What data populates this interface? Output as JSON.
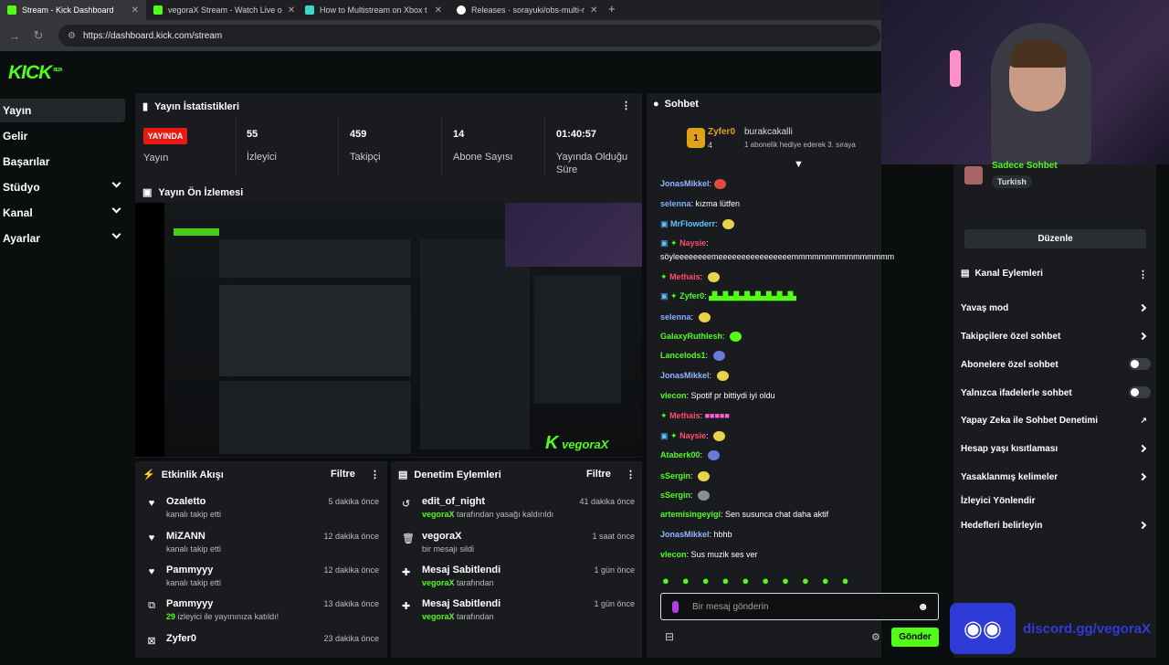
{
  "browser": {
    "tabs": [
      {
        "title": "Stream - Kick Dashboard",
        "active": true,
        "color": "#53fc18"
      },
      {
        "title": "vegoraX Stream - Watch Live o",
        "active": false,
        "color": "#53fc18"
      },
      {
        "title": "How to Multistream on Xbox t",
        "active": false,
        "color": "#3dd6c8"
      },
      {
        "title": "Releases · sorayuki/obs-multi-r",
        "active": false,
        "color": "#ffffff"
      }
    ],
    "url": "https://dashboard.kick.com/stream"
  },
  "brand": {
    "logo": "KICK",
    "logo_sup": "BETA",
    "accent": "#53fc18"
  },
  "sidebar": {
    "items": [
      {
        "label": "Yayın",
        "active": true
      },
      {
        "label": "Gelir"
      },
      {
        "label": "Başarılar"
      },
      {
        "label": "Stüdyo",
        "expandable": true
      },
      {
        "label": "Kanal",
        "expandable": true
      },
      {
        "label": "Ayarlar",
        "expandable": true
      }
    ]
  },
  "stats": {
    "title": "Yayın İstatistikleri",
    "live_badge": "YAYINDA",
    "live_label": "Yayın",
    "cells": [
      {
        "value": "55",
        "label": "İzleyici"
      },
      {
        "value": "459",
        "label": "Takipçi"
      },
      {
        "value": "14",
        "label": "Abone Sayısı"
      },
      {
        "value": "01:40:57",
        "label": "Yayında Olduğu Süre"
      }
    ]
  },
  "preview": {
    "title": "Yayın Ön İzlemesi",
    "watermark": "vegoraX"
  },
  "activity": {
    "title": "Etkinlik Akışı",
    "filter": "Filtre",
    "rows": [
      {
        "icon": "heart-icon",
        "glyph": "♥",
        "name": "Ozaletto",
        "sub": "kanalı takip etti",
        "time": "5 dakika önce"
      },
      {
        "icon": "heart-icon",
        "glyph": "♥",
        "name": "MiZANN",
        "sub": "kanalı takip etti",
        "time": "12 dakika önce"
      },
      {
        "icon": "heart-icon",
        "glyph": "♥",
        "name": "Pammyyy",
        "sub": "kanalı takip etti",
        "time": "12 dakika önce"
      },
      {
        "icon": "raid-icon",
        "glyph": "⧉",
        "name": "Pammyyy",
        "sub_count": "29",
        "sub": "izleyici ile yayınınıza katıldı!",
        "time": "13 dakika önce"
      },
      {
        "icon": "kick-icon",
        "glyph": "⊠",
        "name": "Zyfer0",
        "sub": "",
        "time": "23 dakika önce"
      }
    ]
  },
  "moderation": {
    "title": "Denetim Eylemleri",
    "filter": "Filtre",
    "rows": [
      {
        "icon": "undo-icon",
        "glyph": "↺",
        "name": "edit_of_night",
        "actor": "vegoraX",
        "sub": "tarafından yasağı kaldırıldı",
        "time": "41 dakika önce"
      },
      {
        "icon": "trash-icon",
        "glyph": "🗑",
        "name": "vegoraX",
        "actor": "",
        "sub": "bir mesajı sildi",
        "time": "1 saat önce"
      },
      {
        "icon": "pin-icon",
        "glyph": "📌",
        "name": "Mesaj Sabitlendi",
        "actor": "vegoraX",
        "sub": "tarafından",
        "time": "1 gün önce"
      },
      {
        "icon": "pin-icon",
        "glyph": "📌",
        "name": "Mesaj Sabitlendi",
        "actor": "vegoraX",
        "sub": "tarafından",
        "time": "1 gün önce"
      }
    ]
  },
  "chat": {
    "title": "Sohbet",
    "gifter": {
      "name": "Zyfer0",
      "count": "4",
      "rank": "1"
    },
    "recipient": {
      "name": "burakcakalli",
      "note": "1 abonelik hediye ederek 3. sıraya"
    },
    "messages": [
      {
        "user": "JonasMikkel",
        "color": "#8fb7ff",
        "text": ""
      },
      {
        "user": "selenna",
        "color": "#7fb3ff",
        "text": "kızma lütfen"
      },
      {
        "user": "MrFlowderr",
        "color": "#5ac8ff",
        "text": ""
      },
      {
        "user": "Naysie",
        "color": "#ff4d6d",
        "text": ""
      },
      {
        "user": "",
        "color": "#fff",
        "text": "söyleeeeeeeemeeeeeeeeeeeeeeeemmmmmmmmmmmmmmm"
      },
      {
        "user": "Methais",
        "color": "#ff4d6d",
        "text": ""
      },
      {
        "user": "Zyfer0",
        "color": "#53fc18",
        "text": ""
      },
      {
        "user": "selenna",
        "color": "#7fb3ff",
        "text": ""
      },
      {
        "user": "GalaxyRuthlesh",
        "color": "#53fc18",
        "text": ""
      },
      {
        "user": "Lancelods1",
        "color": "#53fc18",
        "text": ""
      },
      {
        "user": "JonasMikkel",
        "color": "#8fb7ff",
        "text": ""
      },
      {
        "user": "vlecon",
        "color": "#53fc18",
        "text": "Spotif pr bittiydi iyi oldu"
      },
      {
        "user": "Methais",
        "color": "#ff4d6d",
        "text": ""
      },
      {
        "user": "Naysie",
        "color": "#ff4d6d",
        "text": ""
      },
      {
        "user": "Ataberk00",
        "color": "#53fc18",
        "text": ""
      },
      {
        "user": "sSergin",
        "color": "#53fc18",
        "text": ""
      },
      {
        "user": "sSergin",
        "color": "#53fc18",
        "text": ""
      },
      {
        "user": "artemisingeyigi",
        "color": "#53fc18",
        "text": "Sen susunca chat daha aktif"
      },
      {
        "user": "JonasMikkel",
        "color": "#8fb7ff",
        "text": "hbhb"
      },
      {
        "user": "vlecon",
        "color": "#53fc18",
        "text": "Sus muzik ses ver"
      }
    ],
    "input_placeholder": "Bir mesaj gönderin",
    "send_label": "Gönder"
  },
  "channel": {
    "mode_label": "Sadece Sohbet",
    "language": "Turkish",
    "edit_label": "Düzenle",
    "actions_title": "Kanal Eylemleri",
    "actions": [
      {
        "label": "Yavaş mod",
        "control": "chevron"
      },
      {
        "label": "Takipçilere özel sohbet",
        "control": "chevron"
      },
      {
        "label": "Abonelere özel sohbet",
        "control": "toggle"
      },
      {
        "label": "Yalnızca ifadelerle sohbet",
        "control": "toggle"
      },
      {
        "label": "Yapay Zeka ile Sohbet Denetimi",
        "control": "external"
      },
      {
        "label": "Hesap yaşı kısıtlaması",
        "control": "chevron"
      },
      {
        "label": "Yasaklanmış kelimeler",
        "control": "chevron"
      },
      {
        "label": "İzleyici Yönlendir",
        "control": "none"
      },
      {
        "label": "Hedefleri belirleyin",
        "control": "chevron"
      }
    ]
  },
  "overlay": {
    "discord_text": "discord.gg/vegoraX"
  }
}
